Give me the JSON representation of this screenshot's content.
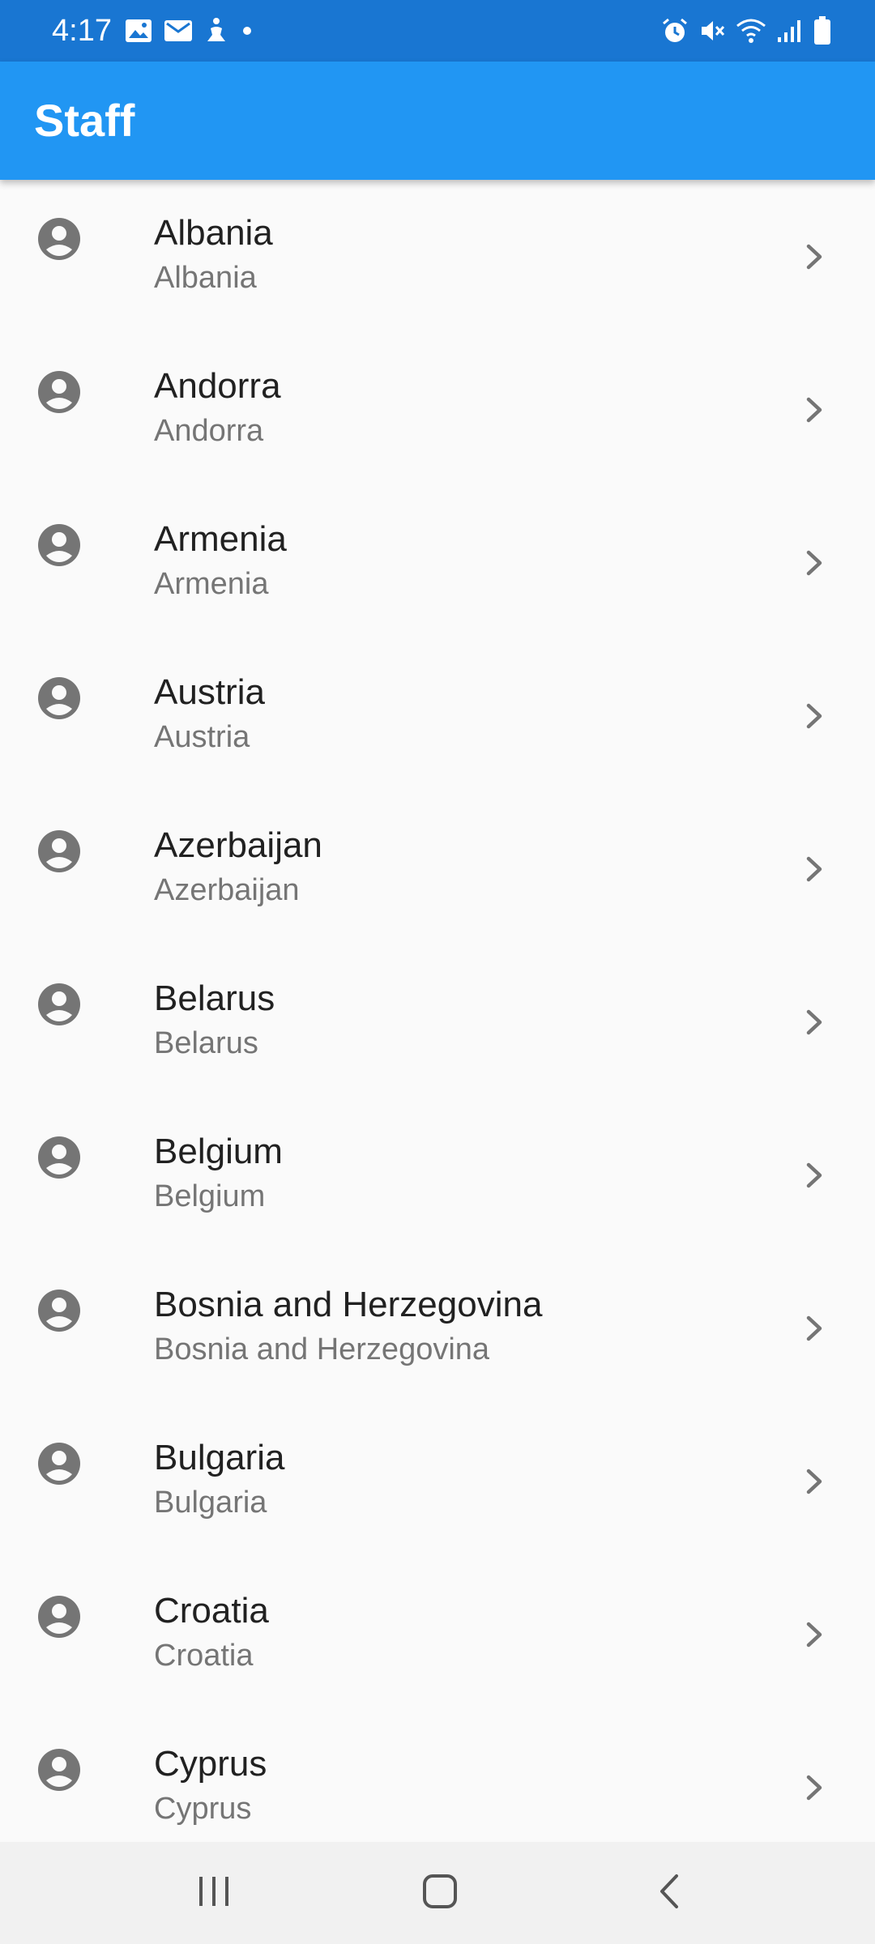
{
  "status_bar": {
    "time": "4:17",
    "left_icons": [
      "image-icon",
      "mail-icon",
      "accessibility-icon",
      "dot-icon"
    ],
    "right_icons": [
      "alarm-icon",
      "mute-icon",
      "wifi-icon",
      "signal-icon",
      "battery-icon"
    ],
    "color": "#1976d2"
  },
  "app_bar": {
    "title": "Staff",
    "color": "#2196f3"
  },
  "list": {
    "items": [
      {
        "title": "Albania",
        "subtitle": "Albania"
      },
      {
        "title": "Andorra",
        "subtitle": "Andorra"
      },
      {
        "title": "Armenia",
        "subtitle": "Armenia"
      },
      {
        "title": "Austria",
        "subtitle": "Austria"
      },
      {
        "title": "Azerbaijan",
        "subtitle": "Azerbaijan"
      },
      {
        "title": "Belarus",
        "subtitle": "Belarus"
      },
      {
        "title": "Belgium",
        "subtitle": "Belgium"
      },
      {
        "title": "Bosnia and Herzegovina",
        "subtitle": "Bosnia and Herzegovina"
      },
      {
        "title": "Bulgaria",
        "subtitle": "Bulgaria"
      },
      {
        "title": "Croatia",
        "subtitle": "Croatia"
      },
      {
        "title": "Cyprus",
        "subtitle": "Cyprus"
      }
    ],
    "item_icon": "account-circle-icon",
    "trailing_icon": "chevron-right-icon"
  },
  "nav_bar": {
    "buttons": [
      "recents-icon",
      "home-icon",
      "back-icon"
    ]
  }
}
